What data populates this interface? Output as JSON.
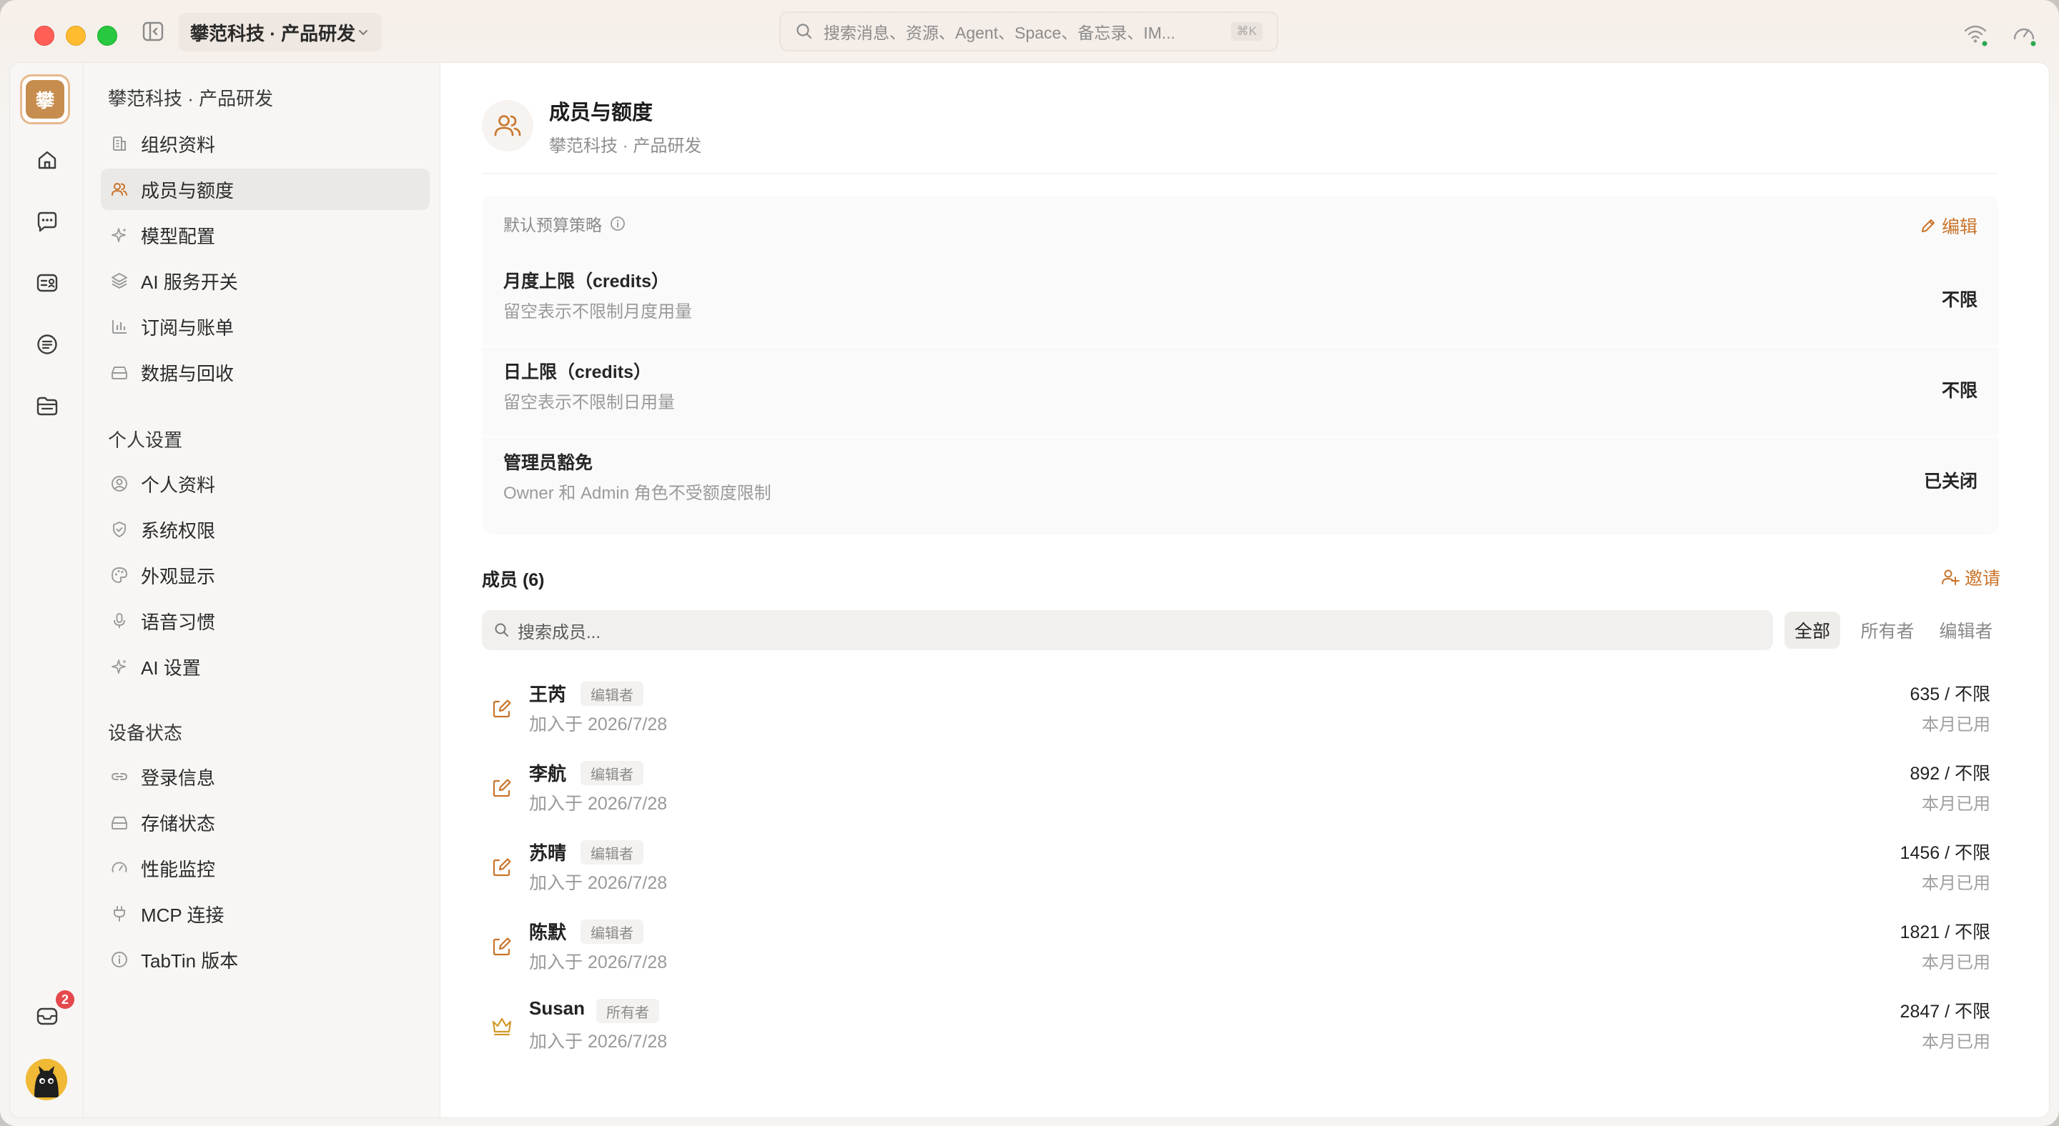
{
  "titlebar": {
    "workspace": "攀范科技 · 产品研发",
    "search_placeholder": "搜索消息、资源、Agent、Space、备忘录、IM...",
    "search_shortcut": "⌘K"
  },
  "rail": {
    "logo_char": "攀",
    "inbox_badge": "2",
    "icons": [
      "home-icon",
      "chat-icon",
      "contacts-icon",
      "notes-icon",
      "folder-icon",
      "inbox-icon"
    ]
  },
  "nav": {
    "workspace_title": "攀范科技 · 产品研发",
    "org_items": [
      {
        "label": "组织资料",
        "icon": "building-icon"
      },
      {
        "label": "成员与额度",
        "icon": "users-icon"
      },
      {
        "label": "模型配置",
        "icon": "sparkle-icon"
      },
      {
        "label": "AI 服务开关",
        "icon": "layers-icon"
      },
      {
        "label": "订阅与账单",
        "icon": "bar-chart-icon"
      },
      {
        "label": "数据与回收",
        "icon": "drive-icon"
      }
    ],
    "personal_title": "个人设置",
    "personal_items": [
      {
        "label": "个人资料",
        "icon": "user-circle-icon"
      },
      {
        "label": "系统权限",
        "icon": "shield-icon"
      },
      {
        "label": "外观显示",
        "icon": "palette-icon"
      },
      {
        "label": "语音习惯",
        "icon": "mic-icon"
      },
      {
        "label": "AI 设置",
        "icon": "sparkle-icon"
      }
    ],
    "device_title": "设备状态",
    "device_items": [
      {
        "label": "登录信息",
        "icon": "link-icon"
      },
      {
        "label": "存储状态",
        "icon": "drive-icon"
      },
      {
        "label": "性能监控",
        "icon": "gauge-icon"
      },
      {
        "label": "MCP 连接",
        "icon": "plug-icon"
      },
      {
        "label": "TabTin 版本",
        "icon": "info-icon"
      }
    ]
  },
  "page": {
    "title": "成员与额度",
    "subtitle": "攀范科技 · 产品研发"
  },
  "policy": {
    "label": "默认预算策略",
    "edit_label": "编辑",
    "rows": [
      {
        "name": "月度上限（credits）",
        "desc": "留空表示不限制月度用量",
        "value": "不限"
      },
      {
        "name": "日上限（credits）",
        "desc": "留空表示不限制日用量",
        "value": "不限"
      },
      {
        "name": "管理员豁免",
        "desc": "Owner 和 Admin 角色不受额度限制",
        "value": "已关闭"
      }
    ]
  },
  "members": {
    "title": "成员 (6)",
    "invite_label": "邀请",
    "search_placeholder": "搜索成员...",
    "filters": [
      "全部",
      "所有者",
      "编辑者"
    ],
    "usage_label": "本月已用",
    "list": [
      {
        "name": "王芮",
        "role": "编辑者",
        "joined": "加入于 2026/7/28",
        "usage": "635 / 不限",
        "icon": "edit-icon"
      },
      {
        "name": "李航",
        "role": "编辑者",
        "joined": "加入于 2026/7/28",
        "usage": "892 / 不限",
        "icon": "edit-icon"
      },
      {
        "name": "苏晴",
        "role": "编辑者",
        "joined": "加入于 2026/7/28",
        "usage": "1456 / 不限",
        "icon": "edit-icon"
      },
      {
        "name": "陈默",
        "role": "编辑者",
        "joined": "加入于 2026/7/28",
        "usage": "1821 / 不限",
        "icon": "edit-icon"
      },
      {
        "name": "Susan",
        "role": "所有者",
        "joined": "加入于 2026/7/28",
        "usage": "2847 / 不限",
        "icon": "crown-icon"
      }
    ]
  },
  "colors": {
    "accent": "#c9742b",
    "badge": "#e5484d"
  }
}
